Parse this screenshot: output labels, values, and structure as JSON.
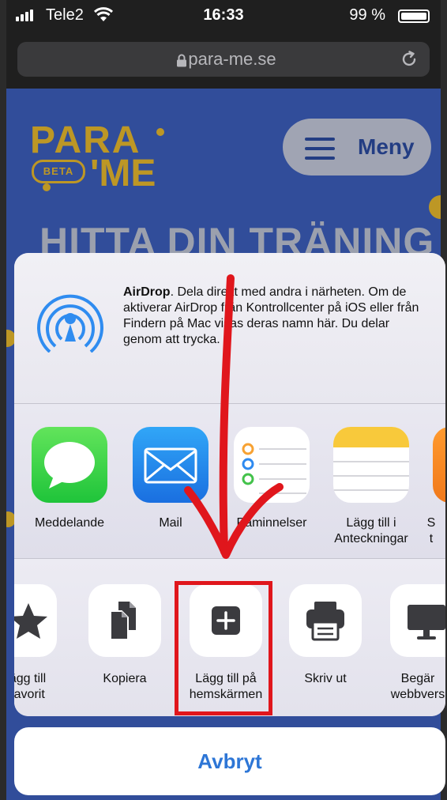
{
  "status_bar": {
    "carrier": "Tele2",
    "time": "16:33",
    "battery_percent": "99 %",
    "battery_level": 0.99
  },
  "browser": {
    "url": "para-me.se"
  },
  "page": {
    "logo": {
      "line1": "PARA",
      "badge": "BETA",
      "line2": "'ME"
    },
    "menu_label": "Meny",
    "heading": "HITTA DIN TRÄNING"
  },
  "share_sheet": {
    "airdrop": {
      "title": "AirDrop",
      "description": ". Dela direkt med andra i närheten. Om de aktiverar AirDrop från Kontrollcenter på iOS eller från Findern på Mac visas deras namn här. Du delar genom att trycka."
    },
    "apps": [
      {
        "label": "Meddelande",
        "icon": "messages-icon"
      },
      {
        "label": "Mail",
        "icon": "mail-icon"
      },
      {
        "label": "Påminnelser",
        "icon": "reminders-icon"
      },
      {
        "label": "Lägg till i\nAnteckningar",
        "icon": "notes-icon"
      },
      {
        "label": "S\nt",
        "icon": "orange-app-icon"
      }
    ],
    "actions": [
      {
        "label": "ägg till\n favorit",
        "icon": "star-icon"
      },
      {
        "label": "Kopiera",
        "icon": "copy-icon"
      },
      {
        "label": "Lägg till på\nhemskärmen",
        "icon": "add-square-icon"
      },
      {
        "label": "Skriv ut",
        "icon": "printer-icon"
      },
      {
        "label": "Begär\nwebbvers",
        "icon": "desktop-icon"
      }
    ]
  },
  "cancel_label": "Avbryt",
  "colors": {
    "accent": "#2d76d6",
    "page_blue": "#3f63c6",
    "brand_yellow": "#f2c230",
    "annotation_red": "#e0161c"
  }
}
